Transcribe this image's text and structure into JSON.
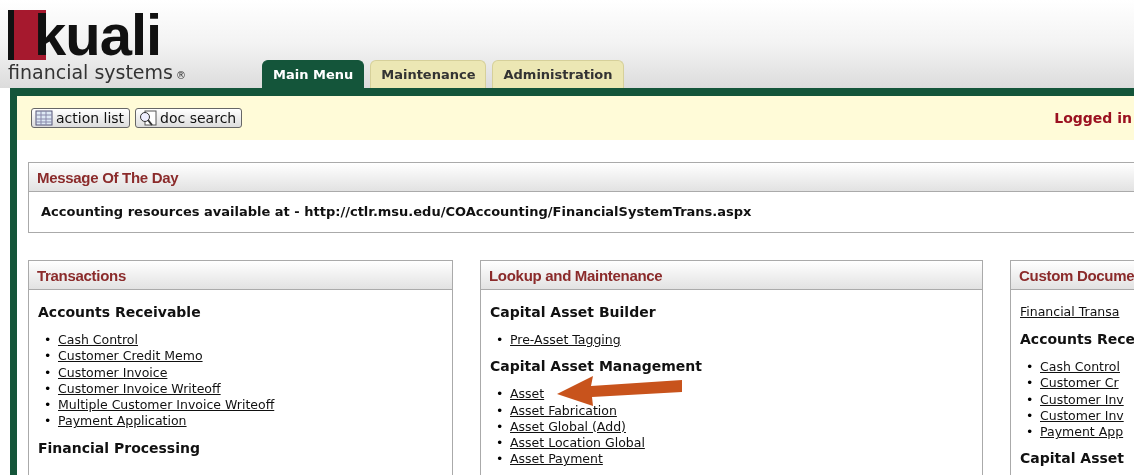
{
  "logo": {
    "name": "kuali",
    "tagline": "financial systems",
    "mark": "®"
  },
  "tabs": [
    {
      "label": "Main Menu",
      "selected": true
    },
    {
      "label": "Maintenance",
      "selected": false
    },
    {
      "label": "Administration",
      "selected": false
    }
  ],
  "toolbar": {
    "buttons": [
      {
        "label": "action list",
        "kind": "list"
      },
      {
        "label": "doc search",
        "kind": "search"
      }
    ],
    "login": "Logged in"
  },
  "message": {
    "title": "Message Of The Day",
    "text": "Accounting resources available at - http://ctlr.msu.edu/COAccounting/FinancialSystemTrans.aspx"
  },
  "columns": [
    {
      "title": "Transactions",
      "blocks": [
        {
          "kind": "heading",
          "text": "Accounts Receivable"
        },
        {
          "kind": "list",
          "bullet": "•",
          "links": [
            "Cash Control",
            "Customer Credit Memo",
            "Customer Invoice",
            "Customer Invoice Writeoff",
            "Multiple Customer Invoice Writeoff",
            "Payment Application"
          ]
        },
        {
          "kind": "heading",
          "text": "Financial Processing"
        }
      ]
    },
    {
      "title": "Lookup and Maintenance",
      "blocks": [
        {
          "kind": "heading",
          "text": "Capital Asset Builder"
        },
        {
          "kind": "list",
          "bullet": "•",
          "links": [
            "Pre-Asset Tagging"
          ]
        },
        {
          "kind": "heading",
          "text": "Capital Asset Management"
        },
        {
          "kind": "list",
          "bullet": "•",
          "links": [
            "Asset",
            "Asset Fabrication",
            "Asset Global (Add)",
            "Asset Location Global",
            "Asset Payment"
          ]
        }
      ]
    },
    {
      "title": "Custom Docume",
      "blocks": [
        {
          "kind": "link",
          "text": "Financial Transa"
        },
        {
          "kind": "heading",
          "text": "Accounts Rece"
        },
        {
          "kind": "list",
          "bullet": "•",
          "links": [
            "Cash Control",
            "Customer Cr",
            "Customer Inv",
            "Customer Inv",
            "Payment App"
          ]
        },
        {
          "kind": "heading",
          "text": "Capital Asset"
        }
      ]
    }
  ]
}
